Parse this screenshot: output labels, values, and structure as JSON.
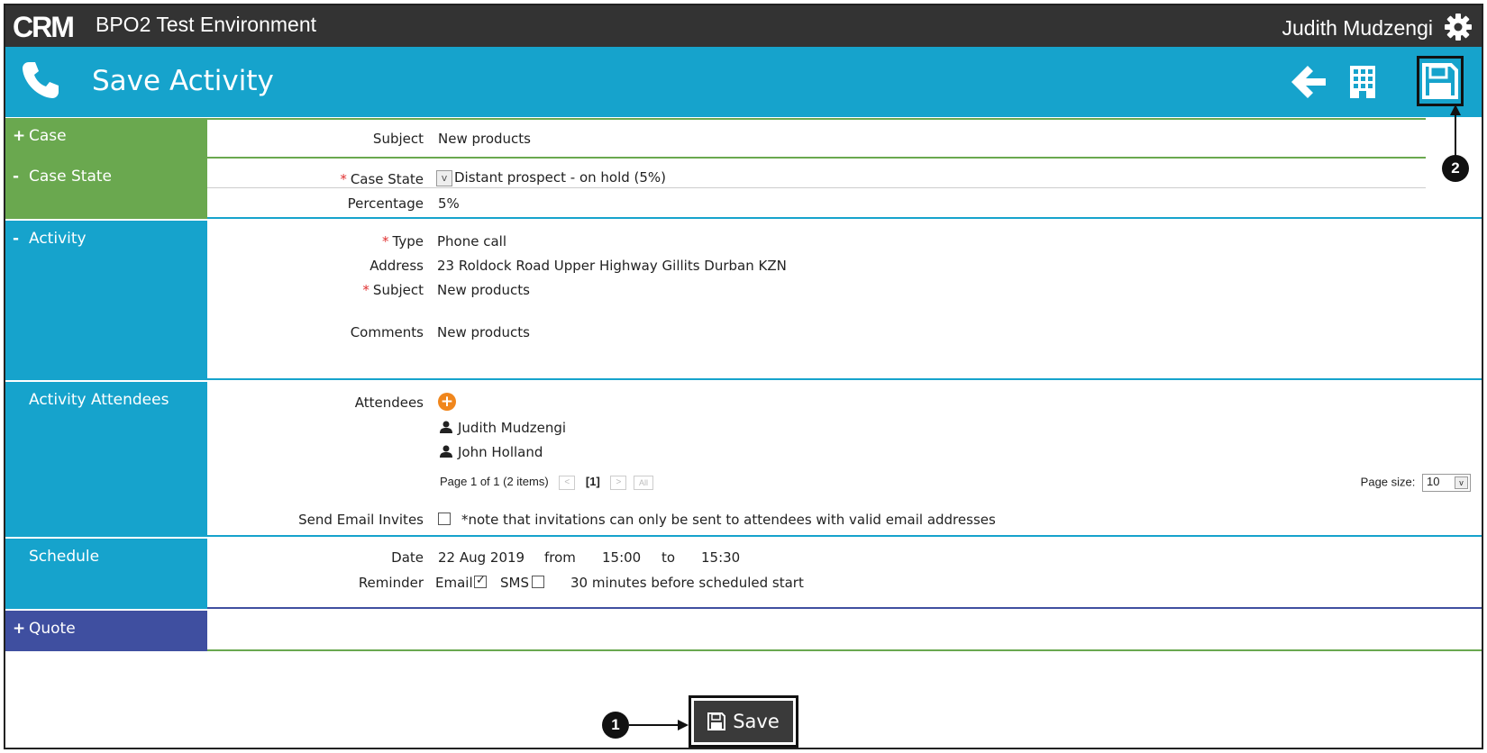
{
  "app": {
    "logo_text": "CRM",
    "environment": "BPO2 Test Environment",
    "user": "Judith Mudzengi"
  },
  "header": {
    "title": "Save Activity"
  },
  "sections": {
    "case": {
      "symbol": "+",
      "label": "Case"
    },
    "case_state": {
      "symbol": "-",
      "label": "Case State"
    },
    "activity": {
      "symbol": "-",
      "label": "Activity"
    },
    "attendees": {
      "label": "Activity Attendees"
    },
    "schedule": {
      "label": "Schedule"
    },
    "quote": {
      "symbol": "+",
      "label": "Quote"
    }
  },
  "case": {
    "subject_label": "Subject",
    "subject_value": "New products"
  },
  "case_state": {
    "state_label": "Case State",
    "state_value": "Distant prospect - on hold (5%)",
    "percentage_label": "Percentage",
    "percentage_value": "5%"
  },
  "activity": {
    "type_label": "Type",
    "type_value": "Phone call",
    "address_label": "Address",
    "address_value": "23 Roldock Road Upper Highway Gillits Durban KZN",
    "subject_label": "Subject",
    "subject_value": "New products",
    "comments_label": "Comments",
    "comments_value": "New products"
  },
  "attendees": {
    "label": "Attendees",
    "add_symbol": "+",
    "list": [
      "Judith Mudzengi",
      "John Holland"
    ],
    "page_info": "Page 1 of 1 (2 items)",
    "current_page": "[1]",
    "all_label": "All",
    "page_size_label": "Page size:",
    "page_size_value": "10",
    "send_invites_label": "Send Email Invites",
    "send_invites_note": "*note that invitations can only be sent to attendees with valid email addresses"
  },
  "schedule": {
    "date_label": "Date",
    "date_value": "22 Aug 2019",
    "from_label": "from",
    "from_value": "15:00",
    "to_label": "to",
    "to_value": "15:30",
    "reminder_label": "Reminder",
    "email_label": "Email",
    "email_checked": true,
    "sms_label": "SMS",
    "sms_checked": false,
    "reminder_text": "30 minutes before scheduled start"
  },
  "footer": {
    "save_label": "Save"
  },
  "callouts": {
    "one": "1",
    "two": "2"
  },
  "colors": {
    "topbar": "#333333",
    "header_blue": "#16a3cc",
    "section_green": "#6aa84f",
    "section_purple": "#3f4fa0",
    "required": "#e03030",
    "add_orange": "#f0861c"
  },
  "icons": {
    "phone": "phone-icon",
    "gear": "gear-icon",
    "back": "arrow-left-icon",
    "building": "building-icon",
    "save": "floppy-disk-icon",
    "person": "person-icon"
  }
}
